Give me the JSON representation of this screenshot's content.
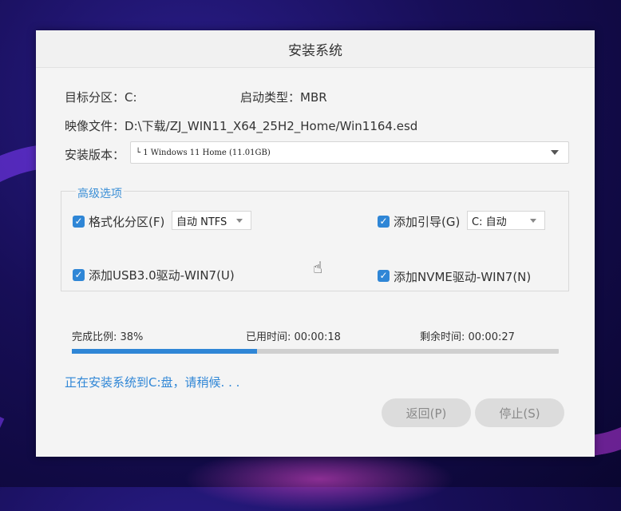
{
  "dialog": {
    "title": "安装系统",
    "partition_label": "目标分区：",
    "partition_value": "C:",
    "boot_type_label": "启动类型：",
    "boot_type_value": "MBR",
    "image_file_label": "映像文件：",
    "image_file_value": "D:\\下载/ZJ_WIN11_X64_25H2_Home/Win1164.esd",
    "version_label": "安装版本：",
    "version_value": "└ 1 Windows 11 Home (11.01GB)"
  },
  "advanced": {
    "title": "高级选项",
    "format_partition": {
      "label": "格式化分区(F)",
      "checked": true,
      "select_value": "自动 NTFS"
    },
    "add_boot": {
      "label": "添加引导(G)",
      "checked": true,
      "select_value": "C: 自动"
    },
    "add_usb3": {
      "label": "添加USB3.0驱动-WIN7(U)",
      "checked": true
    },
    "add_nvme": {
      "label": "添加NVME驱动-WIN7(N)",
      "checked": true
    }
  },
  "progress": {
    "percent_label": "完成比例: 38%",
    "percent": 38,
    "elapsed_label": "已用时间: 00:00:18",
    "remaining_label": "剩余时间: 00:00:27"
  },
  "status_text": "正在安装系统到C:盘，请稍候. . .",
  "buttons": {
    "back": "返回(P)",
    "stop": "停止(S)"
  },
  "icons": {
    "checkbox": "checkmark-icon",
    "dropdown": "chevron-down-icon",
    "cursor": "hand-cursor-icon"
  },
  "colors": {
    "accent": "#2f86d6",
    "button_disabled_bg": "#dcdcdc"
  }
}
